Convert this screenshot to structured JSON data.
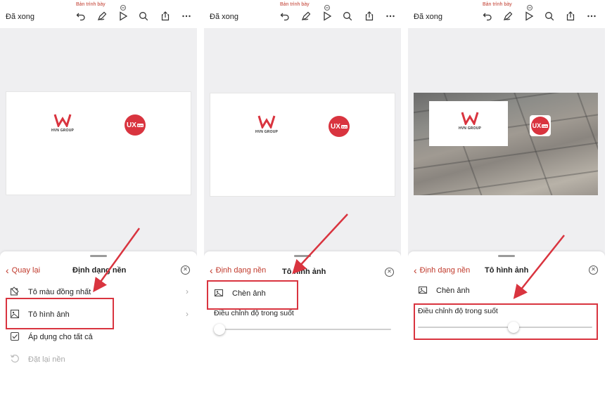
{
  "app": {
    "done_label": "Đã xong",
    "doc_title": "Bản trình bày"
  },
  "slide": {
    "logo_left_text": "HVN GROUP",
    "logo_right_text": "UX",
    "logo_right_suffix": "hvn"
  },
  "panel1": {
    "back_label": "Quay lại",
    "title": "Định dạng nền",
    "rows": [
      {
        "label": "Tô màu đồng nhất",
        "icon": "fill-color-icon"
      },
      {
        "label": "Tô hình ảnh",
        "icon": "image-fill-icon"
      },
      {
        "label": "Áp dụng cho tất cả",
        "icon": "checkbox-icon"
      },
      {
        "label": "Đặt lại nền",
        "icon": "reset-icon"
      }
    ]
  },
  "panel2": {
    "back_label": "Định dạng nền",
    "title": "Tô hình ảnh",
    "insert_label": "Chèn ảnh",
    "slider_label": "Điều chỉnh độ trong suốt",
    "slider_value": 0.0
  },
  "panel3": {
    "back_label": "Định dạng nền",
    "title": "Tô hình ảnh",
    "insert_label": "Chèn ảnh",
    "slider_label": "Điều chỉnh độ trong suốt",
    "slider_value": 0.55
  },
  "colors": {
    "accent": "#c0392b",
    "highlight": "#d9343f"
  }
}
